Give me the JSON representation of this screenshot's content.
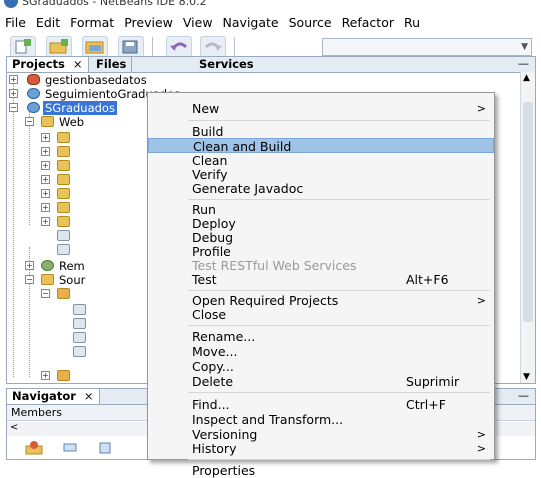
{
  "window": {
    "title": "SGraduados - NetBeans IDE 8.0.2"
  },
  "menubar": [
    "File",
    "Edit",
    "Format",
    "Preview",
    "View",
    "Navigate",
    "Source",
    "Refactor",
    "Ru"
  ],
  "panels": {
    "tabs": [
      "Projects",
      "Files",
      "Services"
    ],
    "close_glyph": "×",
    "minimize_glyph": "—"
  },
  "tree": {
    "items": [
      {
        "label": "gestionbasedatos",
        "icon": "database-project-icon"
      },
      {
        "label": "SeguimientoGraduados",
        "icon": "web-project-icon"
      },
      {
        "label": "SGraduados",
        "icon": "web-project-icon",
        "selected": true
      },
      {
        "label": "Web",
        "icon": "web-pages-folder-icon"
      },
      {
        "label": "Rem",
        "icon": "remote-files-icon"
      },
      {
        "label": "Sour",
        "icon": "source-packages-icon"
      }
    ]
  },
  "navigator": {
    "tab": "Navigator",
    "members_label": "Members"
  },
  "context_menu": {
    "items": [
      {
        "label": "New",
        "submenu": true
      },
      {
        "separator": true
      },
      {
        "label": "Build"
      },
      {
        "label": "Clean and Build",
        "highlighted": true
      },
      {
        "label": "Clean"
      },
      {
        "label": "Verify"
      },
      {
        "label": "Generate Javadoc"
      },
      {
        "separator": true
      },
      {
        "label": "Run"
      },
      {
        "label": "Deploy"
      },
      {
        "label": "Debug"
      },
      {
        "label": "Profile"
      },
      {
        "label": "Test RESTful Web Services",
        "disabled": true
      },
      {
        "label": "Test",
        "shortcut": "Alt+F6"
      },
      {
        "separator": true
      },
      {
        "label": "Open Required Projects",
        "submenu": true
      },
      {
        "label": "Close"
      },
      {
        "separator": true
      },
      {
        "label": "Rename..."
      },
      {
        "label": "Move..."
      },
      {
        "label": "Copy..."
      },
      {
        "label": "Delete",
        "shortcut": "Suprimir"
      },
      {
        "separator": true
      },
      {
        "label": "Find...",
        "shortcut": "Ctrl+F"
      },
      {
        "label": "Inspect and Transform..."
      },
      {
        "label": "Versioning",
        "submenu": true
      },
      {
        "label": "History",
        "submenu": true
      },
      {
        "separator": true
      },
      {
        "label": "Properties"
      }
    ],
    "submenu_glyph": ">"
  },
  "colors": {
    "highlight": "#9ec3e6",
    "selection": "#3875d7",
    "panel_border": "#9aa9bb"
  }
}
